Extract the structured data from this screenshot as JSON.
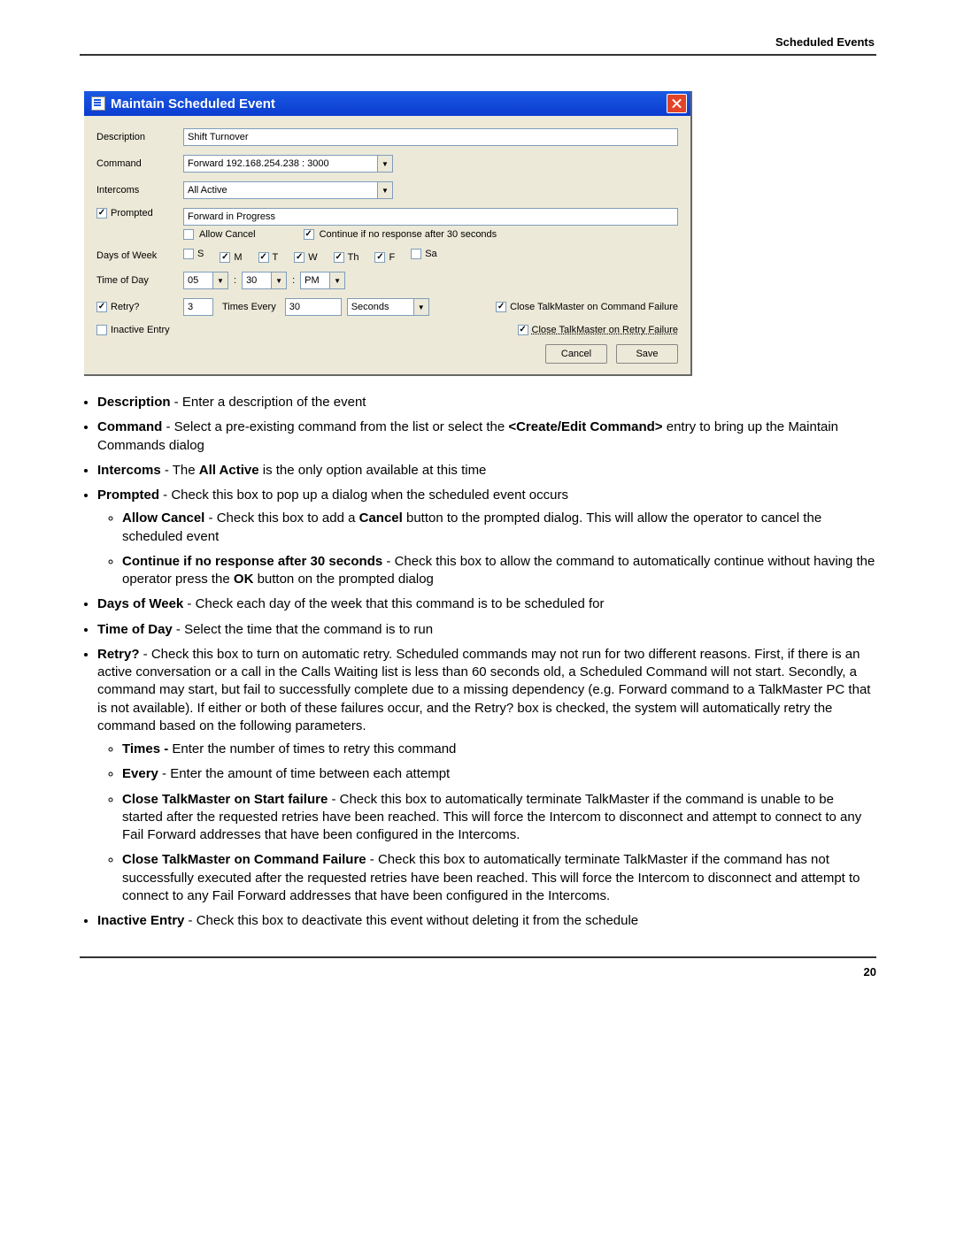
{
  "header": {
    "section_title": "Scheduled Events"
  },
  "footer": {
    "page_number": "20"
  },
  "dialog": {
    "title": "Maintain Scheduled Event",
    "labels": {
      "description": "Description",
      "command": "Command",
      "intercoms": "Intercoms",
      "prompted": "Prompted",
      "allow_cancel": "Allow Cancel",
      "continue_30": "Continue if no response after 30 seconds",
      "days_of_week": "Days of Week",
      "time_of_day": "Time of Day",
      "retry": "Retry?",
      "times_every": "Times Every",
      "close_cmd_fail": "Close TalkMaster on Command Failure",
      "close_retry_fail": "Close TalkMaster on Retry Failure",
      "inactive_entry": "Inactive Entry",
      "cancel": "Cancel",
      "save": "Save"
    },
    "values": {
      "description": "Shift Turnover",
      "command_selected": "Forward 192.168.254.238 : 3000",
      "intercoms_selected": "All Active",
      "prompt_message": "Forward in Progress",
      "retry_times": "3",
      "retry_every_value": "30",
      "retry_every_unit": "Seconds",
      "hour": "05",
      "minute": "30",
      "ampm": "PM"
    },
    "checks": {
      "prompted": true,
      "allow_cancel": false,
      "continue_30": true,
      "retry": true,
      "inactive": false,
      "close_cmd_fail": true,
      "close_retry_fail": true
    },
    "days": [
      {
        "label": "S",
        "checked": false
      },
      {
        "label": "M",
        "checked": true
      },
      {
        "label": "T",
        "checked": true
      },
      {
        "label": "W",
        "checked": true
      },
      {
        "label": "Th",
        "checked": true
      },
      {
        "label": "F",
        "checked": true
      },
      {
        "label": "Sa",
        "checked": false
      }
    ]
  },
  "help": {
    "b_description": "Description",
    "t_description": " - Enter a description of the event",
    "b_command": "Command",
    "t_command_a": " - Select a pre-existing command from the list or select the ",
    "b_command_ce": "<Create/Edit Command>",
    "t_command_b": " entry to bring up the Maintain Commands dialog",
    "b_intercoms": "Intercoms",
    "t_intercoms_a": " - The ",
    "b_allactive": "All Active",
    "t_intercoms_b": " is the only option available at this time",
    "b_prompted": "Prompted",
    "t_prompted": " - Check this box to pop up a dialog when the scheduled event occurs",
    "b_allow_cancel": "Allow Cancel",
    "t_allow_cancel_a": " - Check this box to add a ",
    "b_cancel_word": "Cancel",
    "t_allow_cancel_b": " button to the prompted dialog.  This will allow the operator to cancel the scheduled event",
    "b_continue30": "Continue if no response after 30 seconds",
    "t_continue30_a": " - Check this box to allow the command to automatically continue without having the operator press the ",
    "b_ok": "OK",
    "t_continue30_b": " button on the prompted dialog",
    "b_dow": "Days of Week",
    "t_dow": " - Check each day of the week that this command is to be scheduled for",
    "b_tod": "Time of Day",
    "t_tod": " - Select the time that the command is to run",
    "b_retry": "Retry?",
    "t_retry": " - Check this box to turn on automatic retry.  Scheduled commands may not run for two different reasons.  First, if there is an active conversation or a call in the Calls Waiting list is less than 60 seconds old, a Scheduled Command will not start. Secondly, a command may start, but fail to successfully complete due to a missing dependency (e.g. Forward command to a TalkMaster PC that is not available).  If either or both of these failures occur, and the Retry? box is checked, the system will automatically retry the command based on the following parameters.",
    "b_times": "Times - ",
    "t_times": "Enter the number of times to retry this command",
    "b_every": "Every",
    "t_every": " - Enter the amount of time between each attempt",
    "b_close_start": "Close TalkMaster on Start failure",
    "t_close_start": " - Check this box to automatically terminate TalkMaster if the command is unable to be started after the requested retries have been reached.  This will force the Intercom to disconnect and attempt to connect to any Fail Forward addresses that have been configured in the Intercoms.",
    "b_close_cmd": "Close TalkMaster on Command Failure",
    "t_close_cmd": " - Check this box to automatically terminate TalkMaster if the command has not successfully executed after the requested retries have been reached. This will force the Intercom to disconnect and attempt to connect to any Fail Forward addresses that have been configured in the Intercoms.",
    "b_inactive": "Inactive Entry",
    "t_inactive": " - Check this box to deactivate this event without deleting it from the schedule"
  }
}
